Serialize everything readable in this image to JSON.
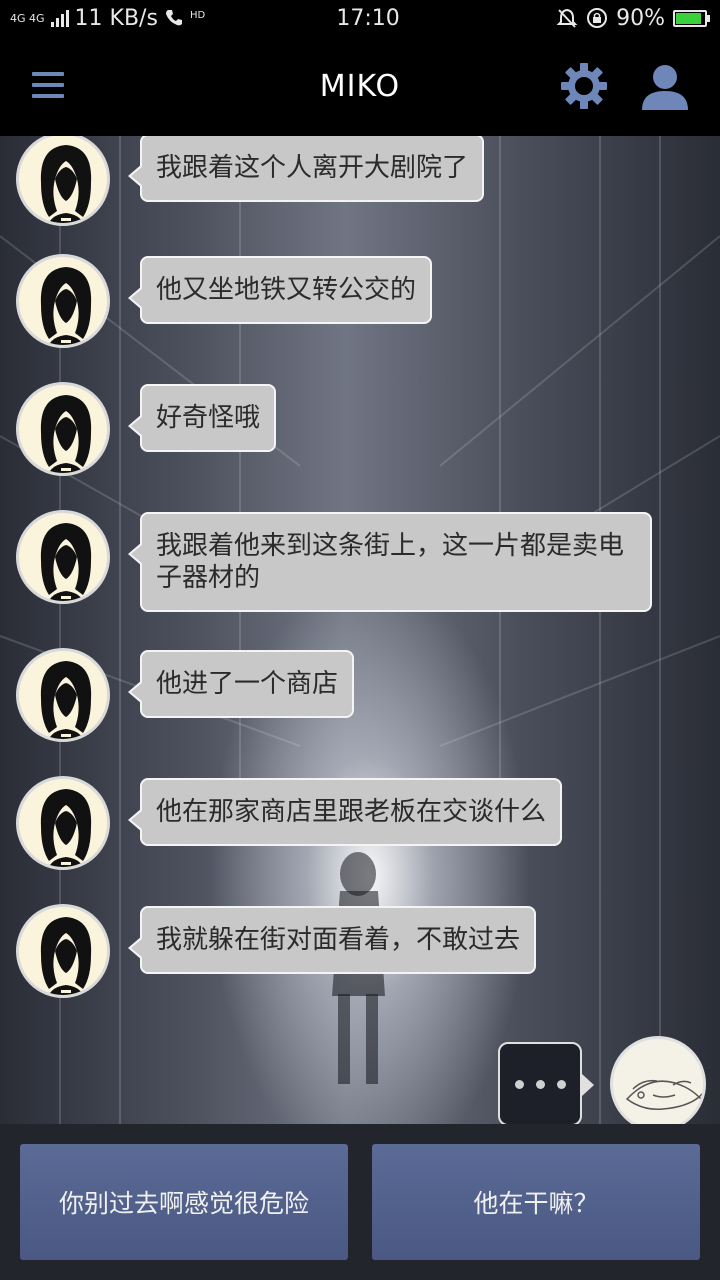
{
  "status_bar": {
    "network": "4G 4G",
    "speed": "11 KB/s",
    "hd": "HD",
    "time": "17:10",
    "battery": "90%",
    "battery_level": 0.9,
    "battery_color": "#3ad23a"
  },
  "header": {
    "title": "MIKO",
    "accent_color": "#6e86b8"
  },
  "messages": [
    {
      "text": "我跟着这个人离开大剧院了"
    },
    {
      "text": "他又坐地铁又转公交的"
    },
    {
      "text": "好奇怪哦"
    },
    {
      "text": "我跟着他来到这条街上，这一片都是卖电子器材的"
    },
    {
      "text": "他进了一个商店"
    },
    {
      "text": "他在那家商店里跟老板在交谈什么"
    },
    {
      "text": "我就躲在街对面看着，不敢过去"
    }
  ],
  "choices": [
    {
      "label": "你别过去啊感觉很危险"
    },
    {
      "label": "他在干嘛？"
    }
  ]
}
